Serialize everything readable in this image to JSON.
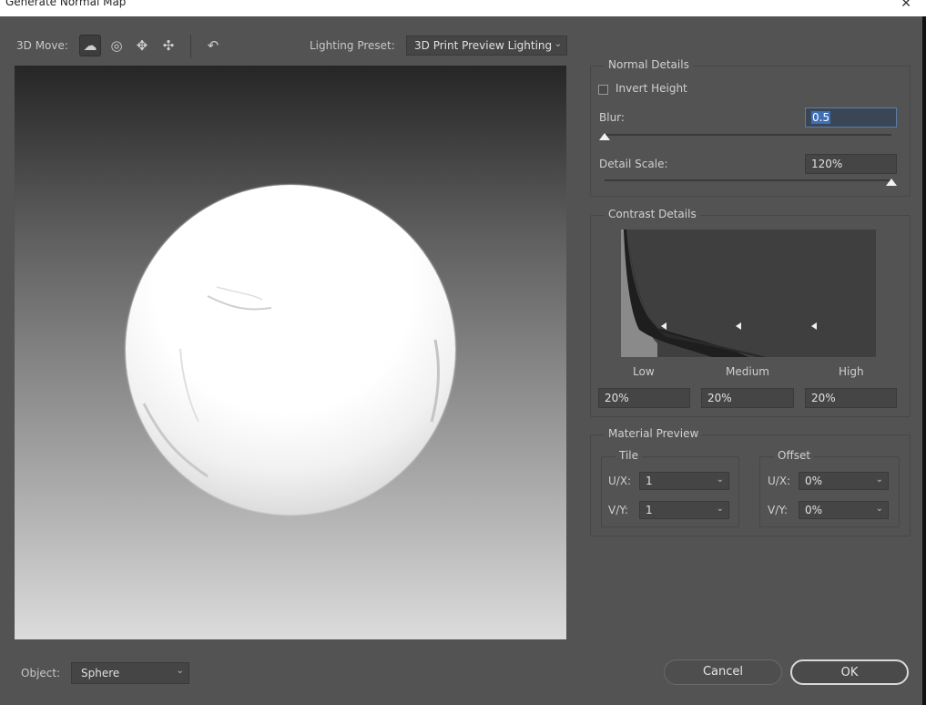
{
  "window": {
    "title": "Generate Normal Map",
    "close_glyph": "✕"
  },
  "toolbar": {
    "move_label": "3D Move:",
    "tools": [
      {
        "name": "orbit-icon",
        "glyph": "☁"
      },
      {
        "name": "roll-icon",
        "glyph": "◎"
      },
      {
        "name": "pan-icon",
        "glyph": "✥"
      },
      {
        "name": "slide-icon",
        "glyph": "✣"
      }
    ],
    "reset_glyph": "↶",
    "lighting_label": "Lighting Preset:",
    "lighting_value": "3D Print Preview Lighting"
  },
  "normal_details": {
    "title": "Normal Details",
    "invert_label": "Invert Height",
    "invert_checked": false,
    "blur_label": "Blur:",
    "blur_value": "0.5",
    "blur_level": 0.0,
    "detail_label": "Detail Scale:",
    "detail_value": "120%",
    "detail_level": 1.0
  },
  "contrast_details": {
    "title": "Contrast Details",
    "low_label": "Low",
    "medium_label": "Medium",
    "high_label": "High",
    "low_value": "20%",
    "medium_value": "20%",
    "high_value": "20%"
  },
  "material_preview": {
    "title": "Material Preview",
    "tile": {
      "title": "Tile",
      "ux_label": "U/X:",
      "ux_value": "1",
      "vy_label": "V/Y:",
      "vy_value": "1"
    },
    "offset": {
      "title": "Offset",
      "ux_label": "U/X:",
      "ux_value": "0%",
      "vy_label": "V/Y:",
      "vy_value": "0%"
    }
  },
  "footer": {
    "object_label": "Object:",
    "object_value": "Sphere",
    "cancel_label": "Cancel",
    "ok_label": "OK"
  },
  "colors": {
    "dialog_bg": "#535353",
    "field_bg": "#454545",
    "accent": "#3f6fb5"
  }
}
